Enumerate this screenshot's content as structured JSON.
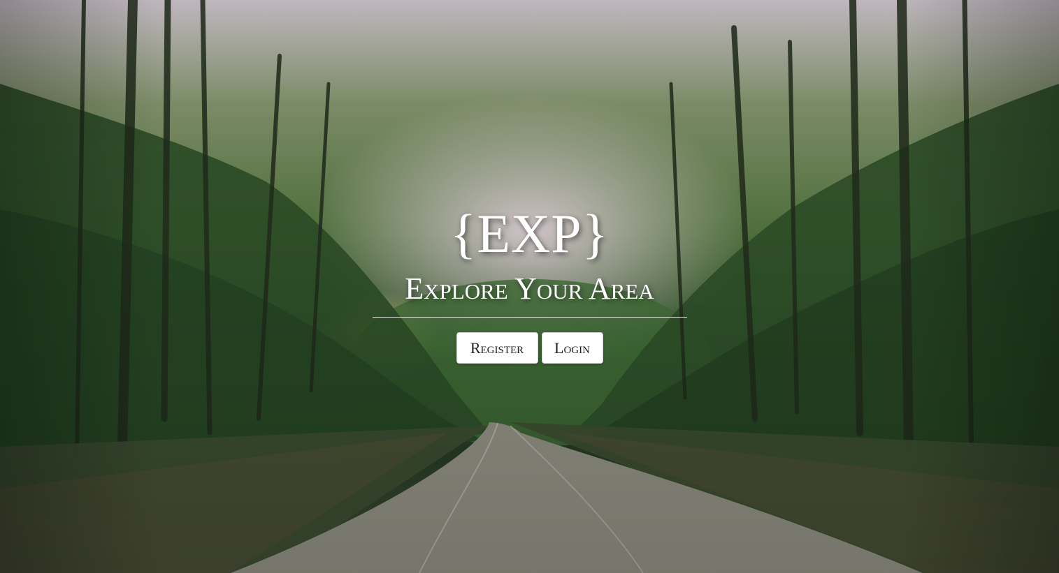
{
  "hero": {
    "logo": "{EXP}",
    "tagline": "Explore Your Area"
  },
  "buttons": {
    "register_label": "Register",
    "login_label": "Login"
  },
  "background": {
    "scene": "forest-road-photo",
    "colors": {
      "sky": "#c9c0c8",
      "foliage": "#2f4f2a",
      "road": "#8a8a7e"
    }
  }
}
